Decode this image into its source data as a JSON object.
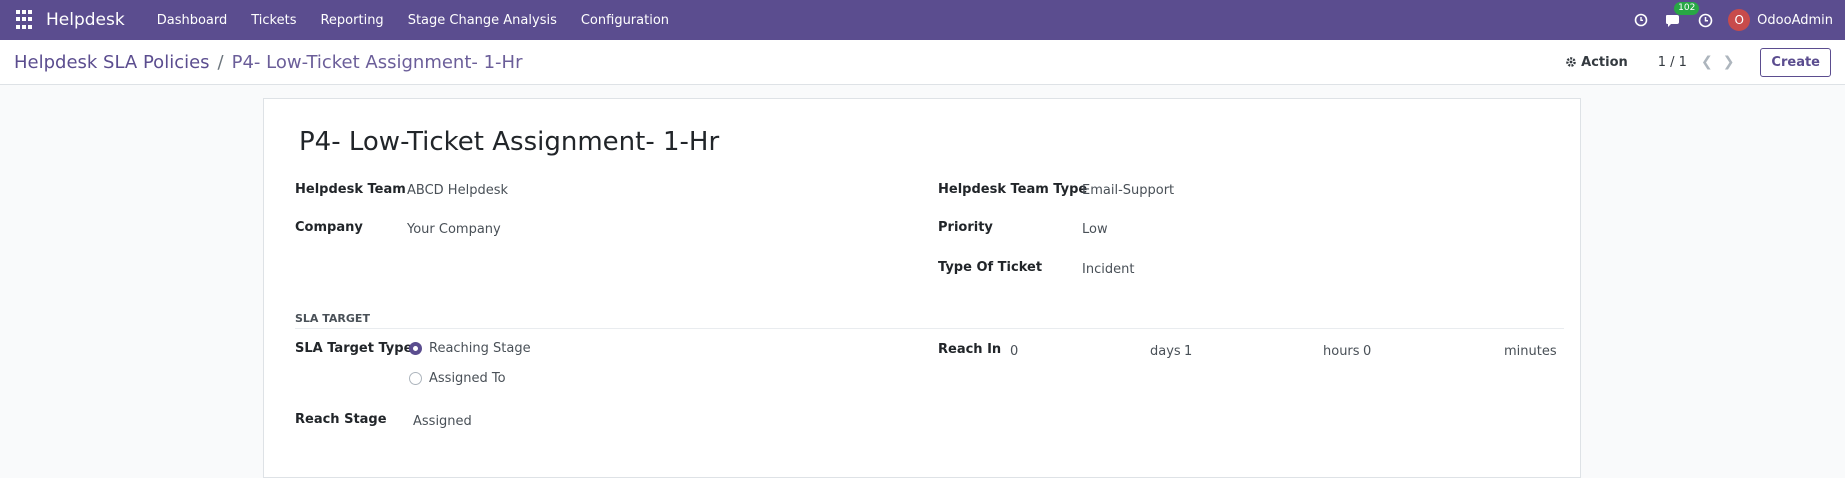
{
  "navbar": {
    "app_name": "Helpdesk",
    "menu": [
      "Dashboard",
      "Tickets",
      "Reporting",
      "Stage Change Analysis",
      "Configuration"
    ],
    "chat_count": "102",
    "user_initial": "O",
    "user_name": "OdooAdmin",
    "icons": [
      "apps-grid-icon",
      "clock-icon",
      "chat-icon",
      "activity-clock-icon"
    ]
  },
  "control_panel": {
    "breadcrumb_parent": "Helpdesk SLA Policies",
    "breadcrumb_sep": "/",
    "breadcrumb_current": "P4- Low-Ticket Assignment- 1-Hr",
    "action_label": "Action",
    "pager": "1 / 1",
    "create_label": "Create"
  },
  "form": {
    "title": "P4- Low-Ticket Assignment- 1-Hr",
    "left_fields": [
      {
        "label": "Helpdesk Team",
        "value": "ABCD Helpdesk"
      },
      {
        "label": "Company",
        "value": "Your Company"
      }
    ],
    "right_fields": [
      {
        "label": "Helpdesk Team Type",
        "value": "Email-Support"
      },
      {
        "label": "Priority",
        "value": "Low"
      },
      {
        "label": "Type Of Ticket",
        "value": "Incident"
      }
    ],
    "sla_section_title": "SLA TARGET",
    "sla_target_type_label": "SLA Target Type",
    "sla_options": [
      {
        "label": "Reaching Stage",
        "checked": true
      },
      {
        "label": "Assigned To",
        "checked": false
      }
    ],
    "reach_stage_label": "Reach Stage",
    "reach_stage_value": "Assigned",
    "reach_in_label": "Reach In",
    "reach_in": {
      "days": "0",
      "days_unit": "days",
      "hours": "1",
      "hours_unit": "hours",
      "minutes": "0",
      "minutes_unit": "minutes"
    }
  },
  "colors": {
    "navbar": "#5b4d8f",
    "accent": "#5b4d8f",
    "badge": "#28a745",
    "avatar": "#c84b4b"
  }
}
